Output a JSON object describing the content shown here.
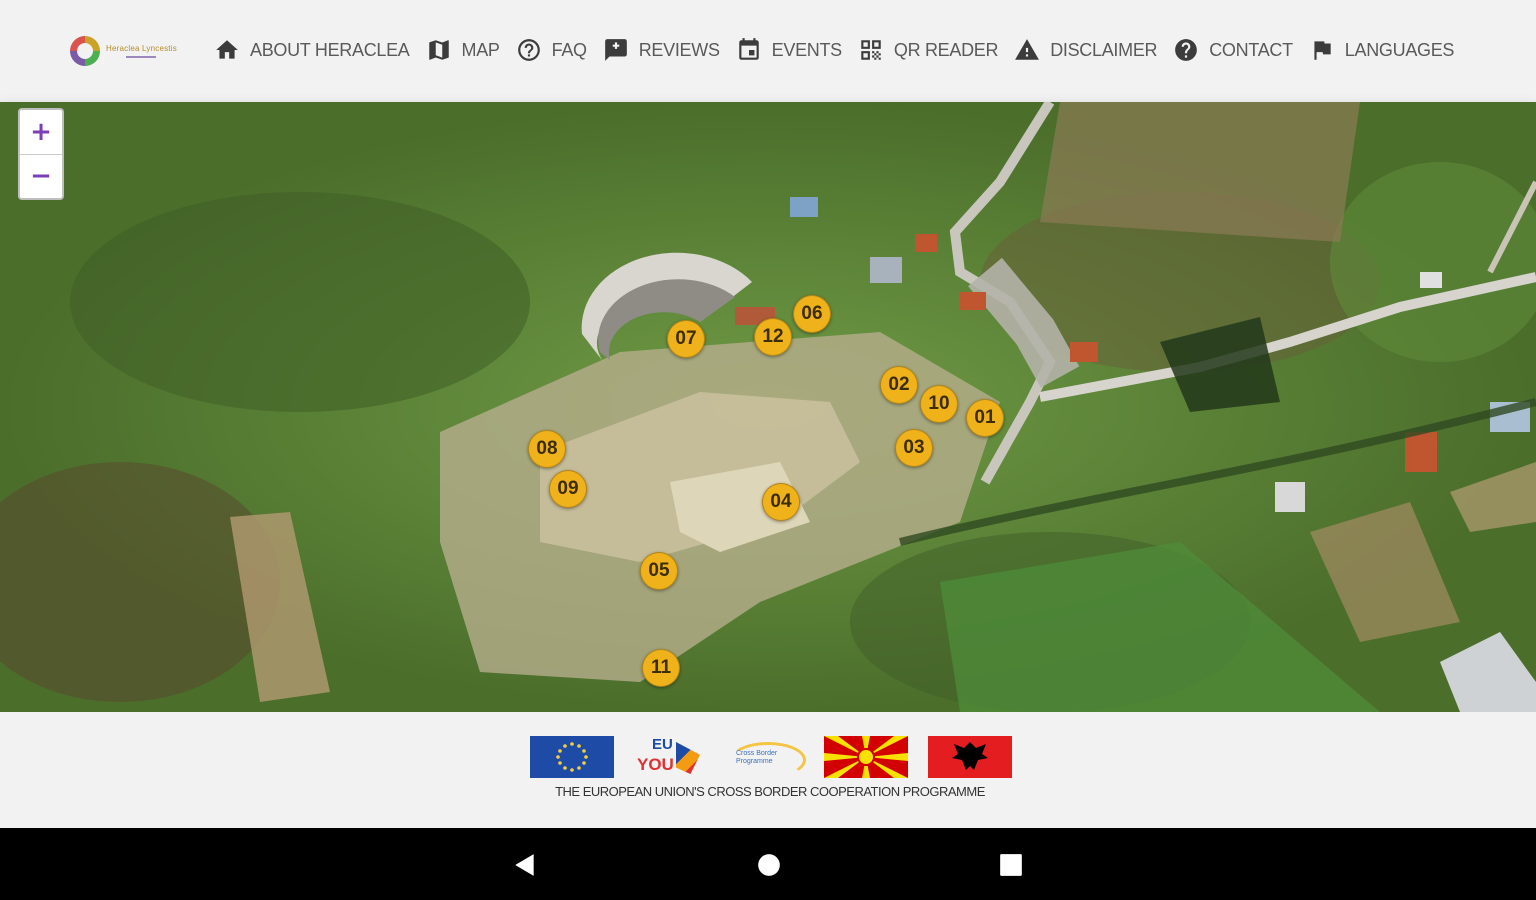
{
  "header": {
    "logo_text": "Heraclea Lyncestis",
    "nav": [
      {
        "label": "ABOUT HERACLEA",
        "icon": "home-icon"
      },
      {
        "label": "MAP",
        "icon": "map-icon"
      },
      {
        "label": "FAQ",
        "icon": "help-circle-icon"
      },
      {
        "label": "REVIEWS",
        "icon": "rate-review-icon"
      },
      {
        "label": "EVENTS",
        "icon": "calendar-icon"
      },
      {
        "label": "QR READER",
        "icon": "qr-code-icon"
      },
      {
        "label": "DISCLAIMER",
        "icon": "warning-icon"
      },
      {
        "label": "CONTACT",
        "icon": "help-badge-icon"
      },
      {
        "label": "LANGUAGES",
        "icon": "flag-icon"
      }
    ]
  },
  "map": {
    "zoom_in": "+",
    "zoom_out": "−",
    "markers": [
      "01",
      "02",
      "03",
      "04",
      "05",
      "06",
      "07",
      "08",
      "09",
      "10",
      "11",
      "12"
    ]
  },
  "footer": {
    "caption": "THE EUROPEAN UNION'S CROSS BORDER COOPERATION PROGRAMME",
    "partner_logos": [
      "eu-flag",
      "eu-for-you-logo",
      "ipa-cross-border-logo",
      "north-macedonia-flag",
      "albania-flag"
    ],
    "eu_for_you_line1": "EU",
    "eu_for_you_line2": "YOU",
    "ipa_text": "Cross Border Programme"
  },
  "system_nav": [
    "back-icon",
    "home-circle-icon",
    "recents-icon"
  ],
  "colors": {
    "marker": "#f0b21b",
    "zoom_accent": "#7b3fb5",
    "nav_text": "#5a5a5a"
  }
}
